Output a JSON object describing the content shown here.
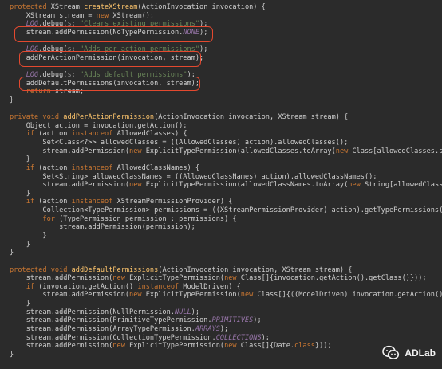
{
  "editor": {
    "lines": [
      [
        [
          "kw",
          "protected"
        ],
        [
          "plain",
          " XStream "
        ],
        [
          "method",
          "createXStream"
        ],
        [
          "plain",
          "(ActionInvocation invocation) {"
        ]
      ],
      [
        [
          "plain",
          "    XStream stream = "
        ],
        [
          "kw",
          "new"
        ],
        [
          "plain",
          " XStream();"
        ]
      ],
      [
        [
          "plain",
          "    "
        ],
        [
          "log",
          "LOG"
        ],
        [
          "plain",
          ".debug("
        ],
        [
          "hint",
          "s:"
        ],
        [
          "str",
          " \"Clears existing permissions\""
        ],
        [
          "plain",
          ");"
        ]
      ],
      [
        [
          "plain",
          "    stream.addPermission(NoTypePermission."
        ],
        [
          "static",
          "NONE"
        ],
        [
          "plain",
          ");"
        ]
      ],
      [
        [
          "plain",
          ""
        ]
      ],
      [
        [
          "plain",
          "    "
        ],
        [
          "log",
          "LOG"
        ],
        [
          "plain",
          ".debug("
        ],
        [
          "hint",
          "s:"
        ],
        [
          "str",
          " \"Adds per action permissions\""
        ],
        [
          "plain",
          ");"
        ]
      ],
      [
        [
          "plain",
          "    addPerActionPermission(invocation, stream);"
        ]
      ],
      [
        [
          "plain",
          ""
        ]
      ],
      [
        [
          "plain",
          "    "
        ],
        [
          "log",
          "LOG"
        ],
        [
          "plain",
          ".debug("
        ],
        [
          "hint",
          "s:"
        ],
        [
          "str",
          " \"Adds default permissions\""
        ],
        [
          "plain",
          ");"
        ]
      ],
      [
        [
          "plain",
          "    addDefaultPermissions(invocation, stream);"
        ]
      ],
      [
        [
          "plain",
          "    "
        ],
        [
          "kw",
          "return"
        ],
        [
          "plain",
          " stream;"
        ]
      ],
      [
        [
          "plain",
          "}"
        ]
      ],
      [
        [
          "plain",
          ""
        ]
      ],
      [
        [
          "kw",
          "private void"
        ],
        [
          "plain",
          " "
        ],
        [
          "method",
          "addPerActionPermission"
        ],
        [
          "plain",
          "(ActionInvocation invocation, XStream stream) {"
        ]
      ],
      [
        [
          "plain",
          "    Object action = invocation.getAction();"
        ]
      ],
      [
        [
          "plain",
          "    "
        ],
        [
          "kw",
          "if"
        ],
        [
          "plain",
          " (action "
        ],
        [
          "kw",
          "instanceof"
        ],
        [
          "plain",
          " AllowedClasses) {"
        ]
      ],
      [
        [
          "plain",
          "        Set<Class<?>> allowedClasses = ((AllowedClasses) action).allowedClasses();"
        ]
      ],
      [
        [
          "plain",
          "        stream.addPermission("
        ],
        [
          "kw",
          "new"
        ],
        [
          "plain",
          " ExplicitTypePermission(allowedClasses.toArray("
        ],
        [
          "kw",
          "new"
        ],
        [
          "plain",
          " Class[allowedClasses.size()])));"
        ]
      ],
      [
        [
          "plain",
          "    }"
        ]
      ],
      [
        [
          "plain",
          "    "
        ],
        [
          "kw",
          "if"
        ],
        [
          "plain",
          " (action "
        ],
        [
          "kw",
          "instanceof"
        ],
        [
          "plain",
          " AllowedClassNames) {"
        ]
      ],
      [
        [
          "plain",
          "        Set<String> allowedClassNames = ((AllowedClassNames) action).allowedClassNames();"
        ]
      ],
      [
        [
          "plain",
          "        stream.addPermission("
        ],
        [
          "kw",
          "new"
        ],
        [
          "plain",
          " ExplicitTypePermission(allowedClassNames.toArray("
        ],
        [
          "kw",
          "new"
        ],
        [
          "plain",
          " String[allowedClassNames.size()])));"
        ]
      ],
      [
        [
          "plain",
          "    }"
        ]
      ],
      [
        [
          "plain",
          "    "
        ],
        [
          "kw",
          "if"
        ],
        [
          "plain",
          " (action "
        ],
        [
          "kw",
          "instanceof"
        ],
        [
          "plain",
          " XStreamPermissionProvider) {"
        ]
      ],
      [
        [
          "plain",
          "        Collection<TypePermission> permissions = ((XStreamPermissionProvider) action).getTypePermissions();"
        ]
      ],
      [
        [
          "plain",
          "        "
        ],
        [
          "kw",
          "for"
        ],
        [
          "plain",
          " (TypePermission permission : permissions) {"
        ]
      ],
      [
        [
          "plain",
          "            stream.addPermission(permission);"
        ]
      ],
      [
        [
          "plain",
          "        }"
        ]
      ],
      [
        [
          "plain",
          "    }"
        ]
      ],
      [
        [
          "plain",
          "}"
        ]
      ],
      [
        [
          "plain",
          ""
        ]
      ],
      [
        [
          "kw",
          "protected void"
        ],
        [
          "plain",
          " "
        ],
        [
          "method",
          "addDefaultPermissions"
        ],
        [
          "plain",
          "(ActionInvocation invocation, XStream stream) {"
        ]
      ],
      [
        [
          "plain",
          "    stream.addPermission("
        ],
        [
          "kw",
          "new"
        ],
        [
          "plain",
          " ExplicitTypePermission("
        ],
        [
          "kw",
          "new"
        ],
        [
          "plain",
          " Class[]{invocation.getAction().getClass()}));"
        ]
      ],
      [
        [
          "plain",
          "    "
        ],
        [
          "kw",
          "if"
        ],
        [
          "plain",
          " (invocation.getAction() "
        ],
        [
          "kw",
          "instanceof"
        ],
        [
          "plain",
          " ModelDriven) {"
        ]
      ],
      [
        [
          "plain",
          "        stream.addPermission("
        ],
        [
          "kw",
          "new"
        ],
        [
          "plain",
          " ExplicitTypePermission("
        ],
        [
          "kw",
          "new"
        ],
        [
          "plain",
          " Class[]{((ModelDriven) invocation.getAction()).getModel().getClass()}));"
        ]
      ],
      [
        [
          "plain",
          "    }"
        ]
      ],
      [
        [
          "plain",
          "    stream.addPermission(NullPermission."
        ],
        [
          "static",
          "NULL"
        ],
        [
          "plain",
          ");"
        ]
      ],
      [
        [
          "plain",
          "    stream.addPermission(PrimitiveTypePermission."
        ],
        [
          "static",
          "PRIMITIVES"
        ],
        [
          "plain",
          ");"
        ]
      ],
      [
        [
          "plain",
          "    stream.addPermission(ArrayTypePermission."
        ],
        [
          "static",
          "ARRAYS"
        ],
        [
          "plain",
          ");"
        ]
      ],
      [
        [
          "plain",
          "    stream.addPermission(CollectionTypePermission."
        ],
        [
          "static",
          "COLLECTIONS"
        ],
        [
          "plain",
          ");"
        ]
      ],
      [
        [
          "plain",
          "    stream.addPermission("
        ],
        [
          "kw",
          "new"
        ],
        [
          "plain",
          " ExplicitTypePermission("
        ],
        [
          "kw",
          "new"
        ],
        [
          "plain",
          " Class[]{Date."
        ],
        [
          "kw",
          "class"
        ],
        [
          "plain",
          "}));"
        ]
      ],
      [
        [
          "plain",
          "}"
        ]
      ]
    ]
  },
  "watermark": {
    "label": "ADLab",
    "icon": "wechat-icon"
  }
}
